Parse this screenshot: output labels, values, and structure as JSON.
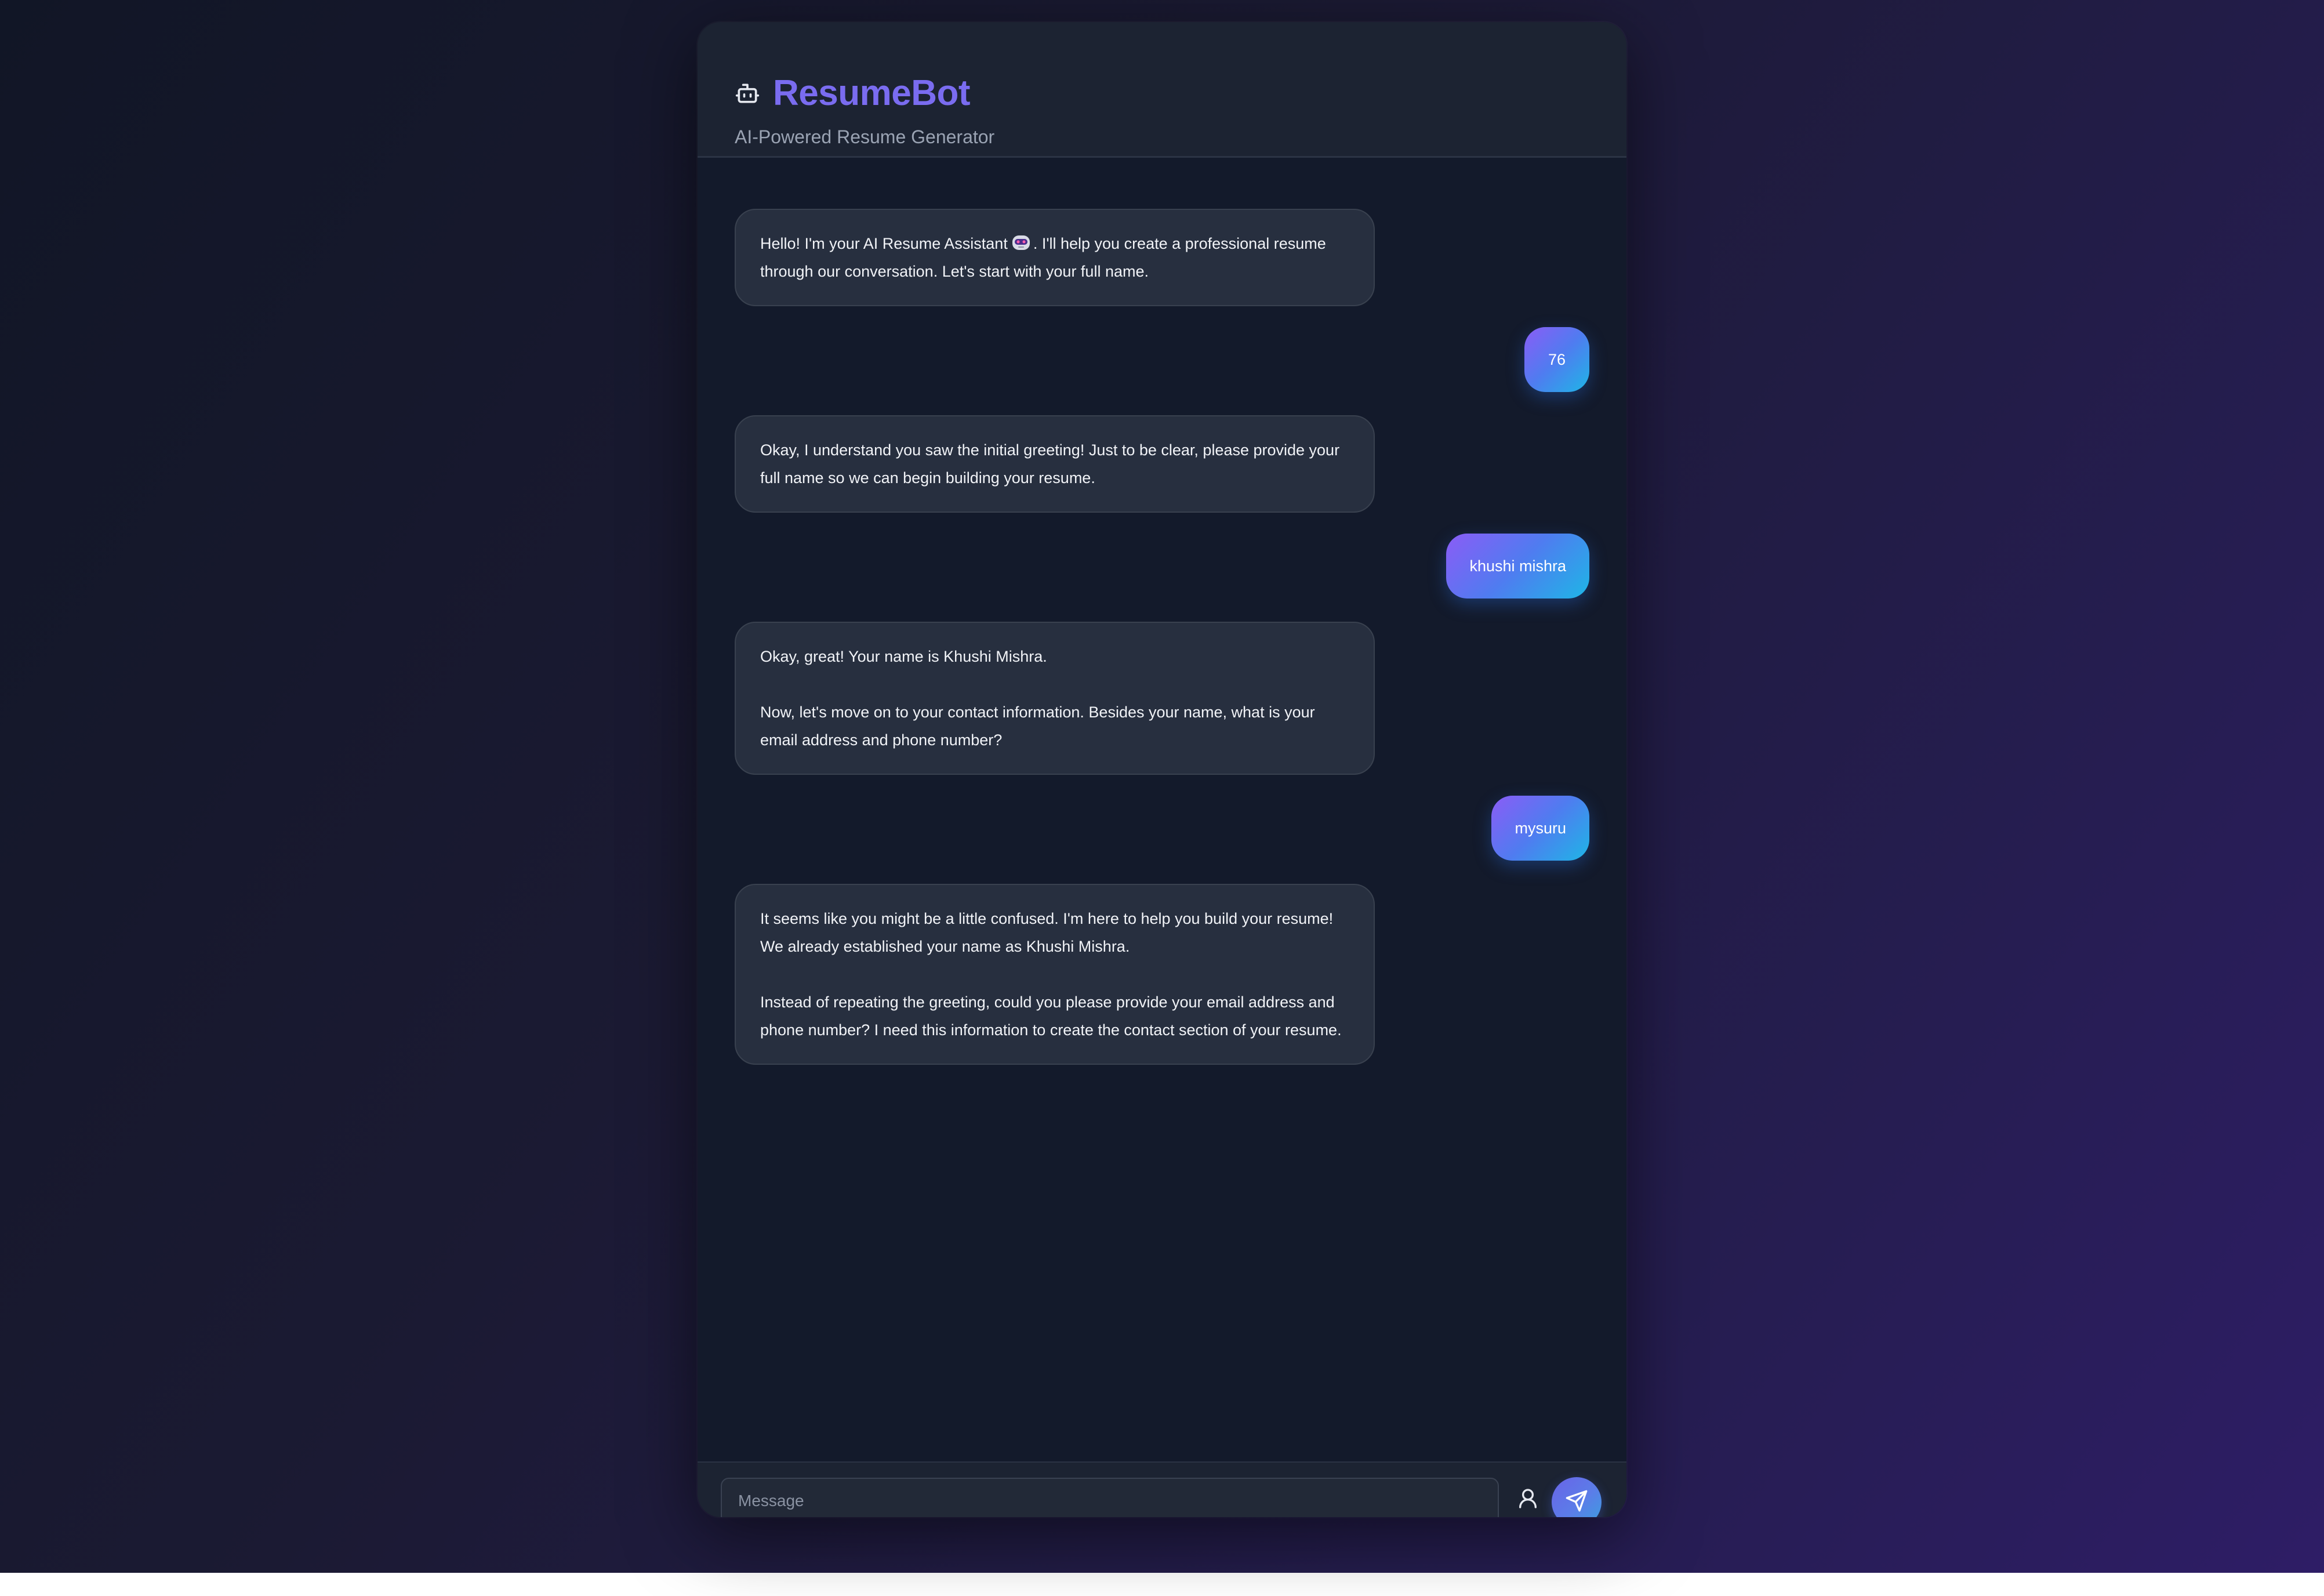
{
  "header": {
    "brand_icon": "robot-icon",
    "title": "ResumeBot",
    "subtitle": "AI-Powered Resume Generator"
  },
  "messages": [
    {
      "role": "bot",
      "paragraphs": [
        {
          "before_emoji": "Hello! I'm your AI Resume Assistant",
          "emoji": "robot-emoji",
          "after_emoji": ". I'll help you create a professional resume through our conversation. Let's start with your full name."
        }
      ]
    },
    {
      "role": "user",
      "text": "76"
    },
    {
      "role": "bot",
      "paragraphs": [
        "Okay, I understand you saw the initial greeting! Just to be clear, please provide your full name so we can begin building your resume."
      ]
    },
    {
      "role": "user",
      "text": "khushi mishra"
    },
    {
      "role": "bot",
      "paragraphs": [
        "Okay, great! Your name is Khushi Mishra.",
        "Now, let's move on to your contact information. Besides your name, what is your email address and phone number?"
      ]
    },
    {
      "role": "user",
      "text": "mysuru"
    },
    {
      "role": "bot",
      "paragraphs": [
        "It seems like you might be a little confused. I'm here to help you build your resume! We already established your name as Khushi Mishra.",
        "Instead of repeating the greeting, could you please provide your email address and phone number? I need this information to create the contact section of your resume."
      ]
    }
  ],
  "composer": {
    "placeholder": "Message",
    "value": "",
    "profile_icon": "user-icon",
    "send_icon": "send-icon"
  },
  "colors": {
    "accent": "#7a6cf0",
    "user_bubble_start": "#8b5cf6",
    "user_bubble_end": "#1eb6e6",
    "bot_bubble": "#272f3f",
    "panel": "#131a2b",
    "header": "#1c2332"
  }
}
